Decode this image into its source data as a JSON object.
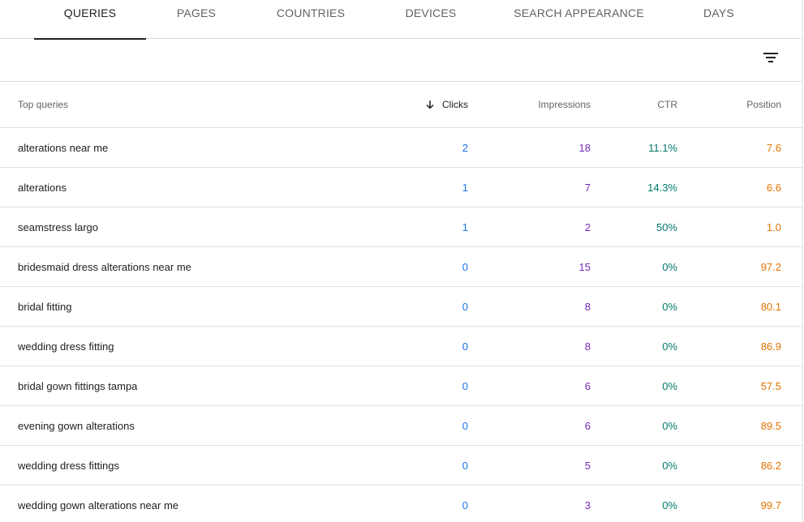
{
  "tabs": [
    {
      "label": "QUERIES",
      "active": true
    },
    {
      "label": "PAGES",
      "active": false
    },
    {
      "label": "COUNTRIES",
      "active": false
    },
    {
      "label": "DEVICES",
      "active": false
    },
    {
      "label": "SEARCH APPEARANCE",
      "active": false
    },
    {
      "label": "DAYS",
      "active": false
    }
  ],
  "toolbar": {
    "filter_icon": "filter-list-icon"
  },
  "table": {
    "headers": {
      "query": "Top queries",
      "clicks": "Clicks",
      "impressions": "Impressions",
      "ctr": "CTR",
      "position": "Position"
    },
    "sort_icon": "arrow-down-icon",
    "rows": [
      {
        "query": "alterations near me",
        "clicks": "2",
        "impressions": "18",
        "ctr": "11.1%",
        "position": "7.6"
      },
      {
        "query": "alterations",
        "clicks": "1",
        "impressions": "7",
        "ctr": "14.3%",
        "position": "6.6"
      },
      {
        "query": "seamstress largo",
        "clicks": "1",
        "impressions": "2",
        "ctr": "50%",
        "position": "1.0"
      },
      {
        "query": "bridesmaid dress alterations near me",
        "clicks": "0",
        "impressions": "15",
        "ctr": "0%",
        "position": "97.2"
      },
      {
        "query": "bridal fitting",
        "clicks": "0",
        "impressions": "8",
        "ctr": "0%",
        "position": "80.1"
      },
      {
        "query": "wedding dress fitting",
        "clicks": "0",
        "impressions": "8",
        "ctr": "0%",
        "position": "86.9"
      },
      {
        "query": "bridal gown fittings tampa",
        "clicks": "0",
        "impressions": "6",
        "ctr": "0%",
        "position": "57.5"
      },
      {
        "query": "evening gown alterations",
        "clicks": "0",
        "impressions": "6",
        "ctr": "0%",
        "position": "89.5"
      },
      {
        "query": "wedding dress fittings",
        "clicks": "0",
        "impressions": "5",
        "ctr": "0%",
        "position": "86.2"
      },
      {
        "query": "wedding gown alterations near me",
        "clicks": "0",
        "impressions": "3",
        "ctr": "0%",
        "position": "99.7"
      }
    ]
  },
  "colors": {
    "clicks": "#1a73e8",
    "impressions": "#7627bb",
    "ctr": "#00796b",
    "position": "#e37400"
  }
}
